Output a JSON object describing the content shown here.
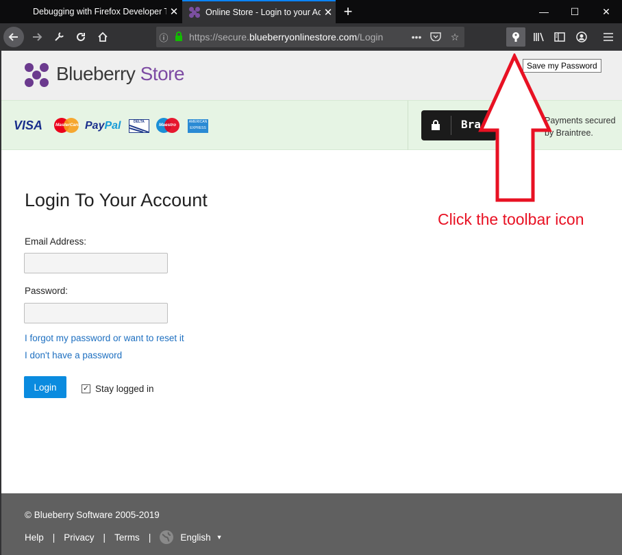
{
  "browser": {
    "tabs": [
      {
        "title": "Debugging with Firefox Developer T"
      },
      {
        "title": "Online Store - Login to your Ac"
      }
    ],
    "new_tab": "+",
    "window_controls": {
      "minimize": "—",
      "maximize": "☐",
      "close": "✕"
    },
    "url_prefix": "https://secure.",
    "url_domain": "blueberryonlinestore.com",
    "url_suffix": "/Login",
    "icons": {
      "back": "back-arrow-icon",
      "forward": "forward-arrow-icon",
      "tools": "wrench-icon",
      "reload": "reload-icon",
      "home": "home-icon",
      "info": "info-icon",
      "lock": "lock-icon",
      "more": "more-actions-icon",
      "pocket": "pocket-icon",
      "bookmark": "star-icon",
      "password": "password-manager-icon",
      "library": "library-icon",
      "sidebar": "sidebar-icon",
      "account": "account-icon",
      "menu": "hamburger-menu-icon"
    },
    "tooltip": "Save my Password"
  },
  "site": {
    "brand_main": "Blueberry",
    "brand_sub": " Store",
    "payments": {
      "visa": "VISA",
      "paypal_pay": "Pay",
      "paypal_pal": "Pal",
      "mastercard_text": "MasterCard",
      "delta_text": "DELTA",
      "maestro_text": "Maestro",
      "amex_text": "AMERICAN EXPRESS",
      "braintree_label": "Bra",
      "secured_line1": "Payments secured",
      "secured_line2": "by Braintree."
    }
  },
  "login": {
    "heading": "Login To Your Account",
    "email_label": "Email Address:",
    "email_value": "",
    "password_label": "Password:",
    "password_value": "",
    "forgot_link": "I forgot my password or want to reset it",
    "no_password_link": "I don't have a password",
    "login_button": "Login",
    "stay_logged_in": "Stay logged in",
    "stay_logged_in_checked": true
  },
  "annotation": {
    "text": "Click the toolbar icon",
    "color": "#e81123"
  },
  "footer": {
    "copyright": "© Blueberry Software 2005-2019",
    "links": [
      "Help",
      "Privacy",
      "Terms"
    ],
    "separator": "|",
    "language": "English"
  },
  "colors": {
    "accent": "#0a8bdf",
    "brand_purple": "#7d4ba3",
    "link": "#1d6fc0",
    "payband": "#e6f4e4",
    "footer": "#606060"
  }
}
